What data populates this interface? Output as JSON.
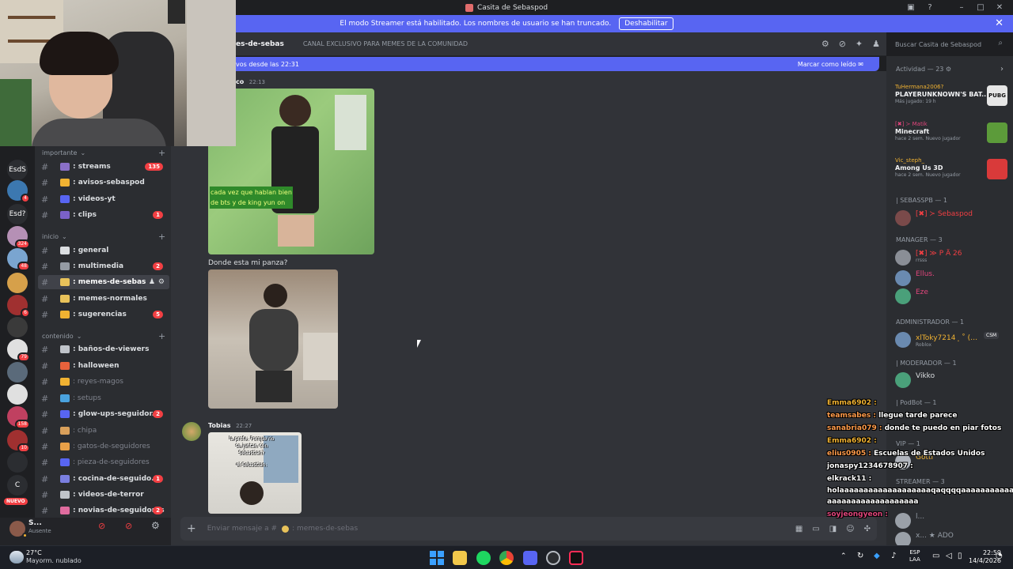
{
  "window": {
    "title": "Casita de Sebaspod"
  },
  "banner": {
    "text": "El modo Streamer está habilitado. Los nombres de usuario se han truncado.",
    "button": "Deshabilitar"
  },
  "header": {
    "channel": "es-de-sebas",
    "topic": "CANAL EXCLUSIVO PARA MEMES DE LA COMUNIDAD",
    "search_placeholder": "Buscar Casita de Sebaspod"
  },
  "newbar": {
    "left": "vos desde las 22:31",
    "right": "Marcar como leído"
  },
  "servers": [
    {
      "label": "EsdS",
      "badge": ""
    },
    {
      "label": "",
      "badge": "4"
    },
    {
      "label": "Esd?",
      "badge": ""
    },
    {
      "label": "",
      "badge": "324"
    },
    {
      "label": "",
      "badge": "48"
    },
    {
      "label": "",
      "badge": ""
    },
    {
      "label": "",
      "badge": "6"
    },
    {
      "label": "",
      "badge": ""
    },
    {
      "label": "",
      "badge": "79"
    },
    {
      "label": "",
      "badge": ""
    },
    {
      "label": "",
      "badge": ""
    },
    {
      "label": "",
      "badge": "158"
    },
    {
      "label": "",
      "badge": "10"
    },
    {
      "label": "",
      "badge": ""
    },
    {
      "label": "C",
      "badge": ""
    }
  ],
  "rail_new": "NUEVO",
  "categories": [
    {
      "name": "importante"
    },
    {
      "name": "inicio"
    },
    {
      "name": "contenido"
    }
  ],
  "channels": [
    {
      "name": "streams",
      "count": "135",
      "muted": false,
      "color": "#8a70c8"
    },
    {
      "name": "avisos-sebaspod",
      "count": "",
      "muted": false,
      "color": "#f0b232"
    },
    {
      "name": "videos-yt",
      "count": "",
      "muted": false,
      "color": "#5865f2"
    },
    {
      "name": "clips",
      "count": "1",
      "muted": false,
      "color": "#7b61c9"
    },
    {
      "name": "general",
      "count": "",
      "muted": false,
      "color": "#dbdee1"
    },
    {
      "name": "multimedia",
      "count": "2",
      "muted": false,
      "color": "#949ba4"
    },
    {
      "name": "memes-de-sebas",
      "count": "",
      "muted": false,
      "color": "#e8c25a"
    },
    {
      "name": "memes-normales",
      "count": "",
      "muted": false,
      "color": "#e8c25a"
    },
    {
      "name": "sugerencias",
      "count": "5",
      "muted": false,
      "color": "#f0b232"
    },
    {
      "name": "baños-de-viewers",
      "count": "",
      "muted": false,
      "color": "#c0c4ca"
    },
    {
      "name": "halloween",
      "count": "",
      "muted": false,
      "color": "#e8623c"
    },
    {
      "name": "reyes-magos",
      "count": "",
      "muted": true,
      "color": "#f0b232"
    },
    {
      "name": "setups",
      "count": "",
      "muted": true,
      "color": "#4aa3df"
    },
    {
      "name": "glow-ups-seguidor...",
      "count": "2",
      "muted": false,
      "color": "#5865f2"
    },
    {
      "name": "chipa",
      "count": "",
      "muted": true,
      "color": "#d9a05b"
    },
    {
      "name": "gatos-de-seguidores",
      "count": "",
      "muted": true,
      "color": "#e8a048"
    },
    {
      "name": "pieza-de-seguidores",
      "count": "",
      "muted": true,
      "color": "#5865f2"
    },
    {
      "name": "cocina-de-seguido...",
      "count": "1",
      "muted": false,
      "color": "#7a7fe0"
    },
    {
      "name": "videos-de-terror",
      "count": "",
      "muted": false,
      "color": "#c0c4ca"
    },
    {
      "name": "novias-de-seguidores",
      "count": "2",
      "muted": false,
      "color": "#e06c9f"
    }
  ],
  "user": {
    "name": "S...",
    "status": "Ausente"
  },
  "messages": [
    {
      "author": "co",
      "time": "22:13",
      "caption_line1": "cada vez que hablan bien",
      "caption_line2": "de bts y de king yun on"
    },
    {
      "text": "Donde esta mi panza?"
    },
    {
      "author": "Tobias",
      "time": "22:27",
      "caption_line1": "la profe: Porque no",
      "caption_line2": "se juntan con Sebastian?",
      "caption_line3": "el Sebastian:"
    }
  ],
  "composer": {
    "placeholder_prefix": "Enviar mensaje a #",
    "channel": ": memes-de-sebas"
  },
  "members": {
    "activity": "Actividad — 23",
    "activities": [
      {
        "user": "TuHermana2006?",
        "game": "PLAYERUNKNOWN'S BAT...",
        "sub": "Más jugado: 19 h",
        "icon_text": "PUBG"
      },
      {
        "user": "[✖] ≻ Matik",
        "game": "Minecraft",
        "sub": "hace 2 sem.",
        "sub2": "Nuevo jugador"
      },
      {
        "user": "Vic_steph_",
        "game": "Among Us 3D",
        "sub": "hace 2 sem.",
        "sub2": "Nuevo jugador"
      }
    ],
    "groups": [
      {
        "label": "| SEBASSPB — 1",
        "members": [
          {
            "name": "[✖] ≻ Sebaspod",
            "color": "#f23f43",
            "sub": ""
          }
        ]
      },
      {
        "label": "MANAGER — 3",
        "members": [
          {
            "name": "[✖] ≫ P Ä 26",
            "color": "#f23f43",
            "sub": "rrsss"
          },
          {
            "name": "Ellus.",
            "color": "#e0457b",
            "sub": ""
          },
          {
            "name": "Eze",
            "color": "#e0457b",
            "sub": ""
          }
        ]
      },
      {
        "label": "ADMINISTRADOR — 1",
        "members": [
          {
            "name": "xlToky7214 ⸼  ˚ (…",
            "color": "#f0b232",
            "sub": "Roblox",
            "tag": "CSM"
          }
        ]
      },
      {
        "label": "| MODERADOR — 1",
        "members": [
          {
            "name": "Vikko",
            "color": "#dbdee1",
            "sub": ""
          }
        ]
      },
      {
        "label": "| PodBot — 1",
        "members": []
      },
      {
        "label": "VIP — 1",
        "members": [
          {
            "name": "Gotti",
            "color": "#f0b232",
            "sub": ""
          }
        ]
      },
      {
        "label": "STREAMER — 3",
        "members": []
      }
    ],
    "bottom_members": [
      {
        "name": "l...",
        "color": "#949ba4"
      },
      {
        "name": "x...",
        "color": "#949ba4",
        "tag": "ADO"
      }
    ]
  },
  "overlay": [
    {
      "user": "Emma6902",
      "msg": "",
      "color": "#f0b232"
    },
    {
      "user": "teamsabes",
      "msg": "llegue tarde parece",
      "color": "#ff9b4a"
    },
    {
      "user": "sanabria079",
      "msg": "donde te puedo en piar fotos",
      "color": "#ff9b4a"
    },
    {
      "user": "Emma6902",
      "msg": "",
      "color": "#f0b232"
    },
    {
      "user": "elius0905",
      "msg": "Escuelas de Estados Unidos",
      "color": "#ff9b4a"
    },
    {
      "user": "jonaspy1234678907",
      "msg": "",
      "color": "#ffffff"
    },
    {
      "user": "elkrack11",
      "msg": "",
      "color": "#ffffff"
    },
    {
      "user": "",
      "msg": "holaaaaaaaaaaaaaaaaaaaqaqqqqaaaaaaaaaaaaa",
      "color": "#ffffff"
    },
    {
      "user": "",
      "msg": "aaaaaaaaaaaaaaaaaaa",
      "color": "#ffffff"
    },
    {
      "user": "soyjeongyeon",
      "msg": "",
      "color": "#e0457b"
    }
  ],
  "taskbar": {
    "weather_temp": "27°C",
    "weather_desc": "Mayorm. nublado",
    "lang1": "ESP",
    "lang2": "LAA",
    "time": "22:59",
    "date": "14/4/2026"
  },
  "colors": {
    "blurple": "#5865f2",
    "red": "#f23f43",
    "bg": "#313338",
    "sidebar": "#2b2d31"
  }
}
